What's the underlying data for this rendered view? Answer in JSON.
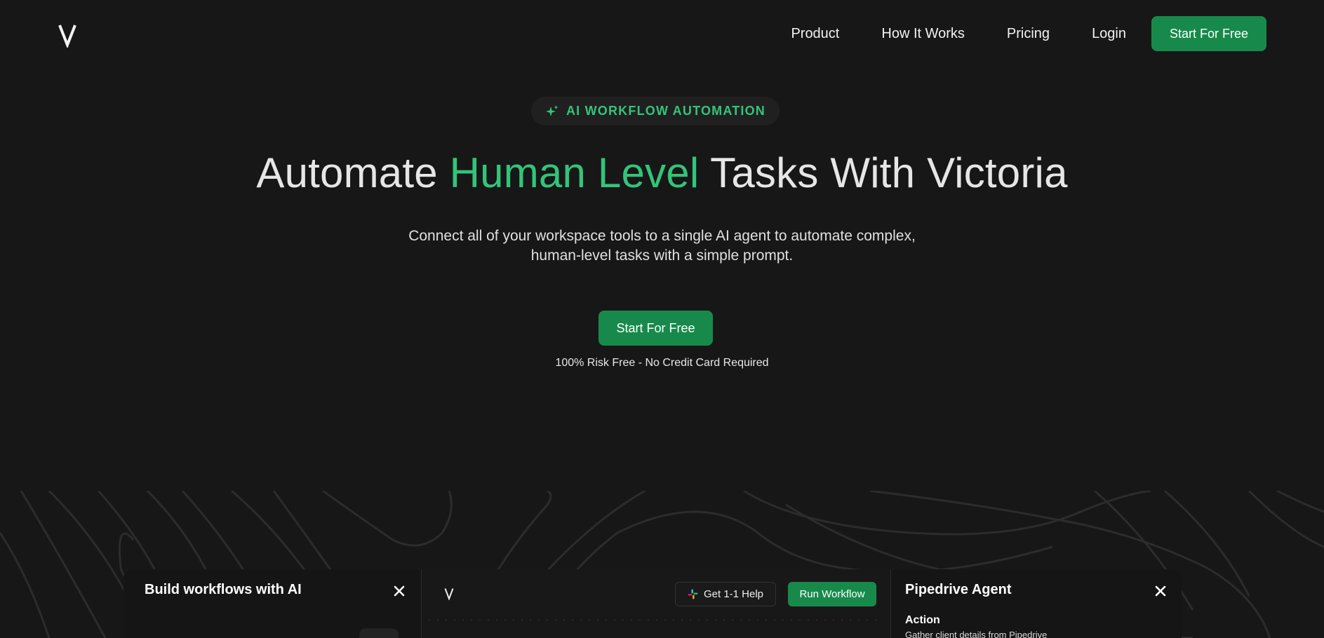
{
  "nav": {
    "logo_icon": "victoria-v-logo",
    "links": [
      "Product",
      "How It Works",
      "Pricing",
      "Login"
    ],
    "cta": "Start For Free"
  },
  "hero": {
    "badge_icon": "sparkle-icon",
    "badge": "AI WORKFLOW AUTOMATION",
    "headline_pre": "Automate ",
    "headline_accent": "Human Level",
    "headline_post": " Tasks With Victoria",
    "subtitle_line1": "Connect all of your workspace tools to a single AI agent to automate complex,",
    "subtitle_line2": "human-level tasks with a simple prompt.",
    "cta": "Start For Free",
    "note": "100% Risk Free - No Credit Card Required"
  },
  "builder": {
    "title": "Build workflows with AI",
    "close_icon": "close-icon"
  },
  "canvas": {
    "logo_icon": "victoria-v-logo",
    "help_icon": "slack-icon",
    "help_label": "Get 1-1 Help",
    "run_label": "Run Workflow"
  },
  "agent": {
    "title": "Pipedrive Agent",
    "action_label": "Action",
    "action_desc": "Gather client details from Pipedrive",
    "close_icon": "close-icon"
  },
  "colors": {
    "background": "#171717",
    "accent_green": "#33c47a",
    "button_green": "#178a4b"
  }
}
